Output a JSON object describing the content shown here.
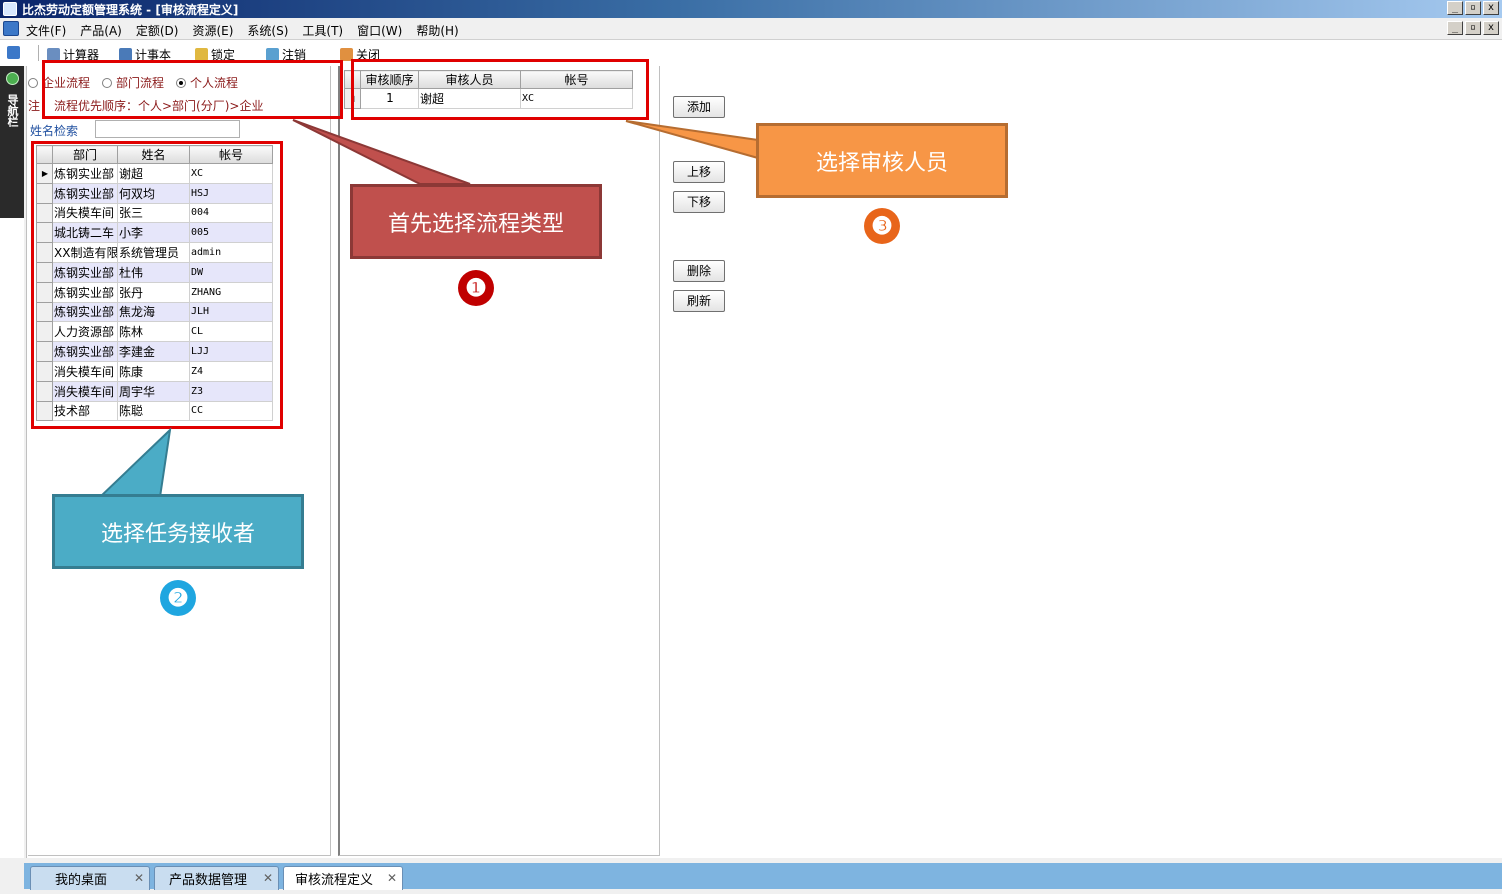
{
  "window": {
    "title": "比杰劳动定额管理系统 - [审核流程定义]"
  },
  "menu": [
    "文件(F)",
    "产品(A)",
    "定额(D)",
    "资源(E)",
    "系统(S)",
    "工具(T)",
    "窗口(W)",
    "帮助(H)"
  ],
  "toolbar": {
    "calculator": "计算器",
    "notepad": "计事本",
    "lock": "锁定",
    "logout": "注销",
    "close": "关闭"
  },
  "nav": {
    "label": "导航栏"
  },
  "flow": {
    "enterprise": "企业流程",
    "department": "部门流程",
    "personal": "个人流程",
    "selected": "个人流程",
    "note": "注",
    "priority": "流程优先顺序：个人>部门(分厂)>企业"
  },
  "search": {
    "label": "姓名检索",
    "value": ""
  },
  "user_grid": {
    "columns": [
      "部门",
      "姓名",
      "帐号"
    ],
    "rows": [
      [
        "炼钢实业部",
        "谢超",
        "XC"
      ],
      [
        "炼钢实业部",
        "何双均",
        "HSJ"
      ],
      [
        "消失模车间",
        "张三",
        "004"
      ],
      [
        "城北铸二车",
        "小李",
        "005"
      ],
      [
        "XX制造有限",
        "系统管理员",
        "admin"
      ],
      [
        "炼钢实业部",
        "杜伟",
        "DW"
      ],
      [
        "炼钢实业部",
        "张丹",
        "ZHANG"
      ],
      [
        "炼钢实业部",
        "焦龙海",
        "JLH"
      ],
      [
        "人力资源部",
        "陈林",
        "CL"
      ],
      [
        "炼钢实业部",
        "李建金",
        "LJJ"
      ],
      [
        "消失模车间",
        "陈康",
        "Z4"
      ],
      [
        "消失模车间",
        "周宇华",
        "Z3"
      ],
      [
        "技术部",
        "陈聪",
        "CC"
      ]
    ]
  },
  "review_grid": {
    "columns": [
      "审核顺序",
      "审核人员",
      "帐号"
    ],
    "rows": [
      [
        "1",
        "谢超",
        "XC"
      ]
    ]
  },
  "buttons": {
    "add": "添加",
    "up": "上移",
    "down": "下移",
    "delete": "删除",
    "refresh": "刷新"
  },
  "callouts": {
    "c1": "首先选择流程类型",
    "n1": "❶",
    "c2": "选择任务接收者",
    "n2": "❷",
    "c3": "选择审核人员",
    "n3": "❸"
  },
  "tabs": [
    "我的桌面",
    "产品数据管理",
    "审核流程定义"
  ],
  "colors": {
    "callout1": "#c0504d",
    "callout2": "#4bacc6",
    "callout3": "#f79646",
    "highlight": "#e00000"
  }
}
